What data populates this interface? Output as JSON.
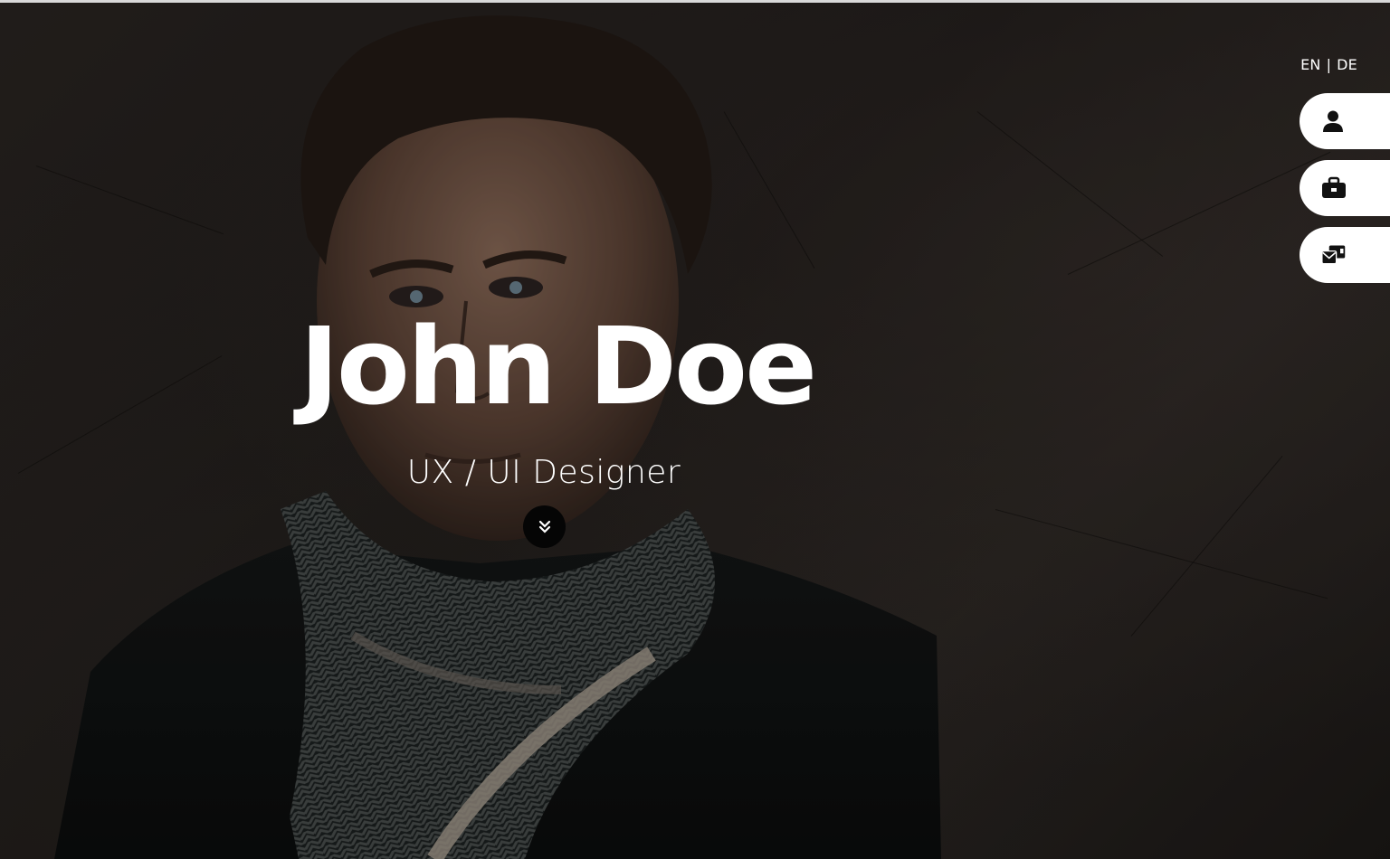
{
  "hero": {
    "name": "John Doe",
    "title": "UX / UI Designer"
  },
  "language_switch": {
    "options": [
      "EN",
      "DE"
    ],
    "separator": "|",
    "selected": "EN"
  },
  "side_nav": {
    "items": [
      {
        "icon": "user-icon"
      },
      {
        "icon": "briefcase-icon"
      },
      {
        "icon": "mail-inbox-icon"
      }
    ]
  },
  "scroll_button": {
    "icon": "double-chevron-down-icon"
  },
  "colors": {
    "background": "#1f1b19",
    "text": "#ffffff",
    "nav_button": "#ffffff",
    "icon": "#111111",
    "scroll_button": "#050505"
  }
}
